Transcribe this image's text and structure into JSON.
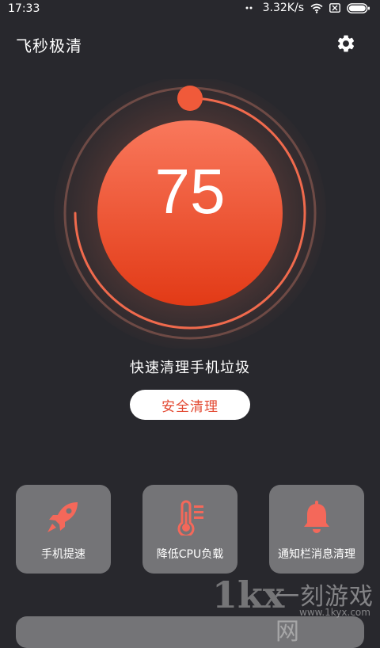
{
  "status_bar": {
    "time": "17:33",
    "speed": "3.32K/s"
  },
  "app": {
    "title": "飞秒极清"
  },
  "score": {
    "value": "75",
    "progress": 0.75
  },
  "main": {
    "subtitle": "快速清理手机垃圾",
    "clean_button": "安全清理"
  },
  "features": [
    {
      "label": "手机提速",
      "icon": "rocket-icon"
    },
    {
      "label": "降低CPU负载",
      "icon": "thermometer-icon"
    },
    {
      "label": "通知栏消息清理",
      "icon": "bell-icon"
    }
  ],
  "watermark": {
    "logo": "1kx",
    "name": "一刻游戏网",
    "url": "www.1kyx.com"
  },
  "colors": {
    "accent": "#f05a3a",
    "background": "#28282d",
    "card": "#747477",
    "button_text": "#e34a33"
  }
}
